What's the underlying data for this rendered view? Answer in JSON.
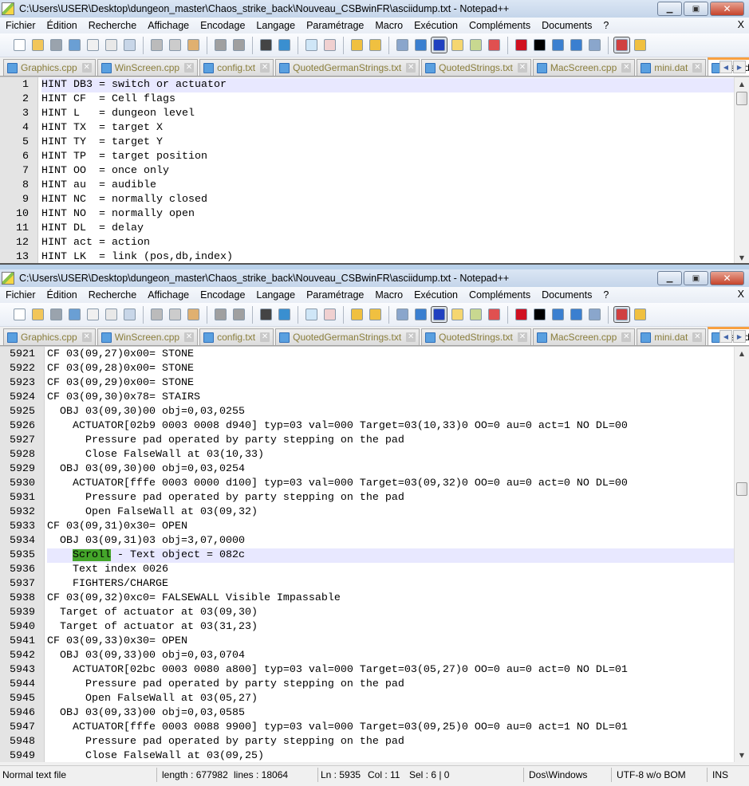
{
  "windows": [
    {
      "title": "C:\\Users\\USER\\Desktop\\dungeon_master\\Chaos_strike_back\\Nouveau_CSBwinFR\\asciidump.txt - Notepad++",
      "menu": [
        "Fichier",
        "Édition",
        "Recherche",
        "Affichage",
        "Encodage",
        "Langage",
        "Paramétrage",
        "Macro",
        "Exécution",
        "Compléments",
        "Documents",
        "?"
      ],
      "menu_close": "X",
      "tabs": [
        {
          "label": "Graphics.cpp",
          "active": false
        },
        {
          "label": "WinScreen.cpp",
          "active": false
        },
        {
          "label": "config.txt",
          "active": false
        },
        {
          "label": "QuotedGermanStrings.txt",
          "active": false
        },
        {
          "label": "QuotedStrings.txt",
          "active": false
        },
        {
          "label": "MacScreen.cpp",
          "active": false
        },
        {
          "label": "mini.dat",
          "active": false
        },
        {
          "label": "asciidump.txt",
          "active": true
        }
      ],
      "current_line": 1,
      "lines": [
        {
          "n": "1",
          "t": "HINT DB3 = switch or actuator"
        },
        {
          "n": "2",
          "t": "HINT CF  = Cell flags"
        },
        {
          "n": "3",
          "t": "HINT L   = dungeon level"
        },
        {
          "n": "4",
          "t": "HINT TX  = target X"
        },
        {
          "n": "5",
          "t": "HINT TY  = target Y"
        },
        {
          "n": "6",
          "t": "HINT TP  = target position"
        },
        {
          "n": "7",
          "t": "HINT OO  = once only"
        },
        {
          "n": "8",
          "t": "HINT au  = audible"
        },
        {
          "n": "9",
          "t": "HINT NC  = normally closed"
        },
        {
          "n": "10",
          "t": "HINT NO  = normally open"
        },
        {
          "n": "11",
          "t": "HINT DL  = delay"
        },
        {
          "n": "12",
          "t": "HINT act = action"
        },
        {
          "n": "13",
          "t": "HINT LK  = link (pos,db,index)"
        }
      ]
    },
    {
      "title": "C:\\Users\\USER\\Desktop\\dungeon_master\\Chaos_strike_back\\Nouveau_CSBwinFR\\asciidump.txt - Notepad++",
      "menu": [
        "Fichier",
        "Édition",
        "Recherche",
        "Affichage",
        "Encodage",
        "Langage",
        "Paramétrage",
        "Macro",
        "Exécution",
        "Compléments",
        "Documents",
        "?"
      ],
      "menu_close": "X",
      "tabs": [
        {
          "label": "Graphics.cpp",
          "active": false
        },
        {
          "label": "WinScreen.cpp",
          "active": false
        },
        {
          "label": "config.txt",
          "active": false
        },
        {
          "label": "QuotedGermanStrings.txt",
          "active": false
        },
        {
          "label": "QuotedStrings.txt",
          "active": false
        },
        {
          "label": "MacScreen.cpp",
          "active": false
        },
        {
          "label": "mini.dat",
          "active": false
        },
        {
          "label": "asciidump.txt",
          "active": true
        }
      ],
      "current_line": 5935,
      "selected_text": "Scroll",
      "lines": [
        {
          "n": "5921",
          "t": "CF 03(09,27)0x00= STONE"
        },
        {
          "n": "5922",
          "t": "CF 03(09,28)0x00= STONE"
        },
        {
          "n": "5923",
          "t": "CF 03(09,29)0x00= STONE"
        },
        {
          "n": "5924",
          "t": "CF 03(09,30)0x78= STAIRS"
        },
        {
          "n": "5925",
          "t": "  OBJ 03(09,30)00 obj=0,03,0255"
        },
        {
          "n": "5926",
          "t": "    ACTUATOR[02b9 0003 0008 d940] typ=03 val=000 Target=03(10,33)0 OO=0 au=0 act=1 NO DL=00"
        },
        {
          "n": "5927",
          "t": "      Pressure pad operated by party stepping on the pad"
        },
        {
          "n": "5928",
          "t": "      Close FalseWall at 03(10,33)"
        },
        {
          "n": "5929",
          "t": "  OBJ 03(09,30)00 obj=0,03,0254"
        },
        {
          "n": "5930",
          "t": "    ACTUATOR[fffe 0003 0000 d100] typ=03 val=000 Target=03(09,32)0 OO=0 au=0 act=0 NO DL=00"
        },
        {
          "n": "5931",
          "t": "      Pressure pad operated by party stepping on the pad"
        },
        {
          "n": "5932",
          "t": "      Open FalseWall at 03(09,32)"
        },
        {
          "n": "5933",
          "t": "CF 03(09,31)0x30= OPEN"
        },
        {
          "n": "5934",
          "t": "  OBJ 03(09,31)03 obj=3,07,0000"
        },
        {
          "n": "5935",
          "t": "    Scroll - Text object = 082c"
        },
        {
          "n": "5936",
          "t": "    Text index 0026"
        },
        {
          "n": "5937",
          "t": "    FIGHTERS/CHARGE"
        },
        {
          "n": "5938",
          "t": "CF 03(09,32)0xc0= FALSEWALL Visible Impassable"
        },
        {
          "n": "5939",
          "t": "  Target of actuator at 03(09,30)"
        },
        {
          "n": "5940",
          "t": "  Target of actuator at 03(31,23)"
        },
        {
          "n": "5941",
          "t": "CF 03(09,33)0x30= OPEN"
        },
        {
          "n": "5942",
          "t": "  OBJ 03(09,33)00 obj=0,03,0704"
        },
        {
          "n": "5943",
          "t": "    ACTUATOR[02bc 0003 0080 a800] typ=03 val=000 Target=03(05,27)0 OO=0 au=0 act=0 NO DL=01"
        },
        {
          "n": "5944",
          "t": "      Pressure pad operated by party stepping on the pad"
        },
        {
          "n": "5945",
          "t": "      Open FalseWall at 03(05,27)"
        },
        {
          "n": "5946",
          "t": "  OBJ 03(09,33)00 obj=0,03,0585"
        },
        {
          "n": "5947",
          "t": "    ACTUATOR[fffe 0003 0088 9900] typ=03 val=000 Target=03(09,25)0 OO=0 au=0 act=1 NO DL=01"
        },
        {
          "n": "5948",
          "t": "      Pressure pad operated by party stepping on the pad"
        },
        {
          "n": "5949",
          "t": "      Close FalseWall at 03(09,25)"
        }
      ],
      "status": {
        "type": "Normal text file",
        "length": "length : 677982",
        "lines": "lines : 18064",
        "ln": "Ln : 5935",
        "col": "Col : 11",
        "sel": "Sel : 6 | 0",
        "eol": "Dos\\Windows",
        "encoding": "UTF-8 w/o BOM",
        "mode": "INS"
      }
    }
  ],
  "toolbar": [
    {
      "icon": "new-file-icon",
      "color": "#ffffff"
    },
    {
      "icon": "open-file-icon",
      "color": "#f2c65a"
    },
    {
      "icon": "save-icon",
      "color": "#9aa3ad"
    },
    {
      "icon": "save-all-icon",
      "color": "#6a9fd4"
    },
    {
      "icon": "close-file-icon",
      "color": "#f0f0f0"
    },
    {
      "icon": "close-all-icon",
      "color": "#e8e8e8"
    },
    {
      "icon": "print-icon",
      "color": "#c8d6e8"
    },
    {
      "sep": true
    },
    {
      "icon": "cut-icon",
      "color": "#bbbbbb"
    },
    {
      "icon": "copy-icon",
      "color": "#cccccc"
    },
    {
      "icon": "paste-icon",
      "color": "#e0b070"
    },
    {
      "sep": true
    },
    {
      "icon": "undo-icon",
      "color": "#a0a0a0"
    },
    {
      "icon": "redo-icon",
      "color": "#a0a0a0"
    },
    {
      "sep": true
    },
    {
      "icon": "find-icon",
      "color": "#444444"
    },
    {
      "icon": "replace-icon",
      "color": "#3a8fd0"
    },
    {
      "sep": true
    },
    {
      "icon": "zoom-in-icon",
      "color": "#cfe6f7"
    },
    {
      "icon": "zoom-out-icon",
      "color": "#f0d0d0"
    },
    {
      "sep": true
    },
    {
      "icon": "sync-vertical-icon",
      "color": "#f0c040"
    },
    {
      "icon": "sync-horizontal-icon",
      "color": "#f0c040"
    },
    {
      "sep": true
    },
    {
      "icon": "word-wrap-icon",
      "color": "#8aa6cc"
    },
    {
      "icon": "show-all-chars-icon",
      "color": "#3a7fd0"
    },
    {
      "icon": "indent-guide-icon",
      "color": "#2040c0",
      "pressed": true
    },
    {
      "icon": "user-language-icon",
      "color": "#f5d670"
    },
    {
      "icon": "document-map-icon",
      "color": "#c8d890"
    },
    {
      "icon": "function-list-icon",
      "color": "#e05050"
    },
    {
      "sep": true
    },
    {
      "icon": "record-macro-icon",
      "color": "#d01020"
    },
    {
      "icon": "stop-macro-icon",
      "color": "#000000"
    },
    {
      "icon": "play-macro-icon",
      "color": "#3a7fd0"
    },
    {
      "icon": "run-macro-multiple-icon",
      "color": "#3a7fd0"
    },
    {
      "icon": "save-macro-icon",
      "color": "#8aa6cc"
    },
    {
      "sep": true
    },
    {
      "icon": "spell-check-icon",
      "color": "#d04040",
      "pressed": true
    },
    {
      "icon": "plugin-folder-icon",
      "color": "#f0c040"
    }
  ],
  "colors": {
    "selection_highlight": "#44a52a",
    "current_line": "#e8e8ff",
    "active_tab_accent": "#f8a040"
  }
}
